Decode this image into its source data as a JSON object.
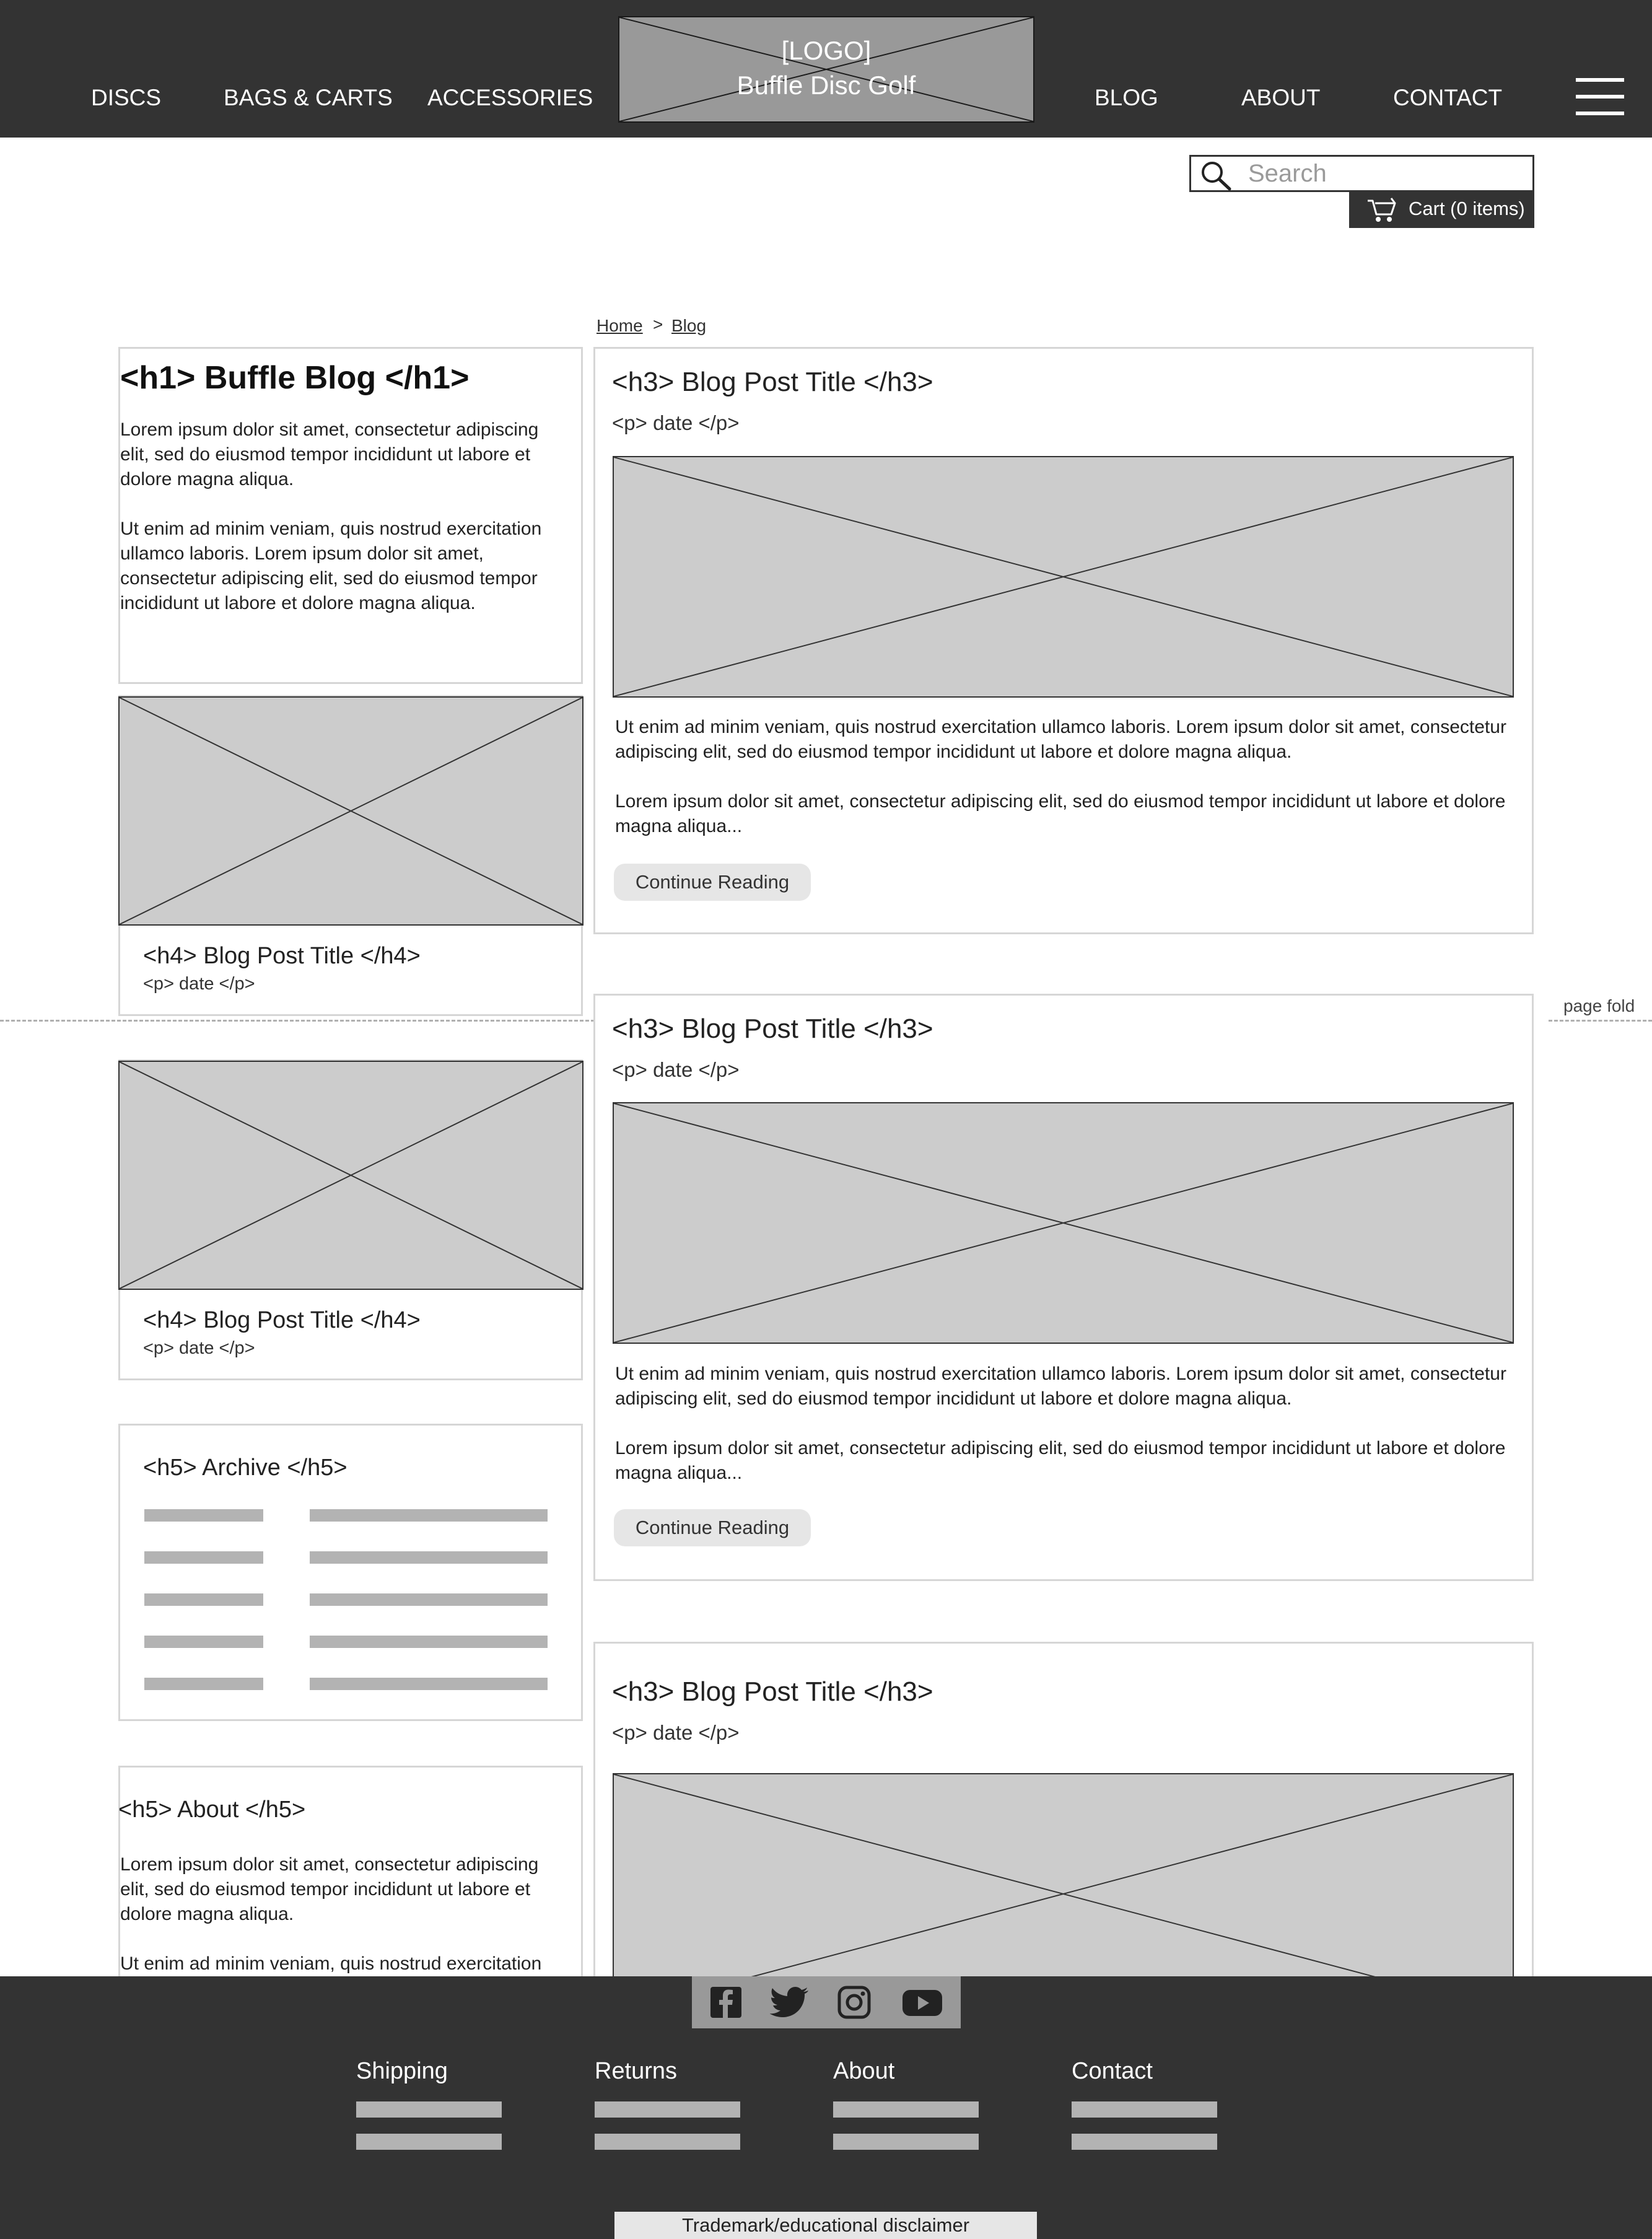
{
  "header": {
    "nav_left": [
      "DISCS",
      "BAGS & CARTS",
      "ACCESSORIES"
    ],
    "nav_right": [
      "BLOG",
      "ABOUT",
      "CONTACT"
    ],
    "logo_line1": "[LOGO]",
    "logo_line2": "Buffle Disc Golf",
    "menu_icon": "hamburger-menu-icon"
  },
  "search": {
    "placeholder": "Search",
    "icon": "search-icon"
  },
  "cart": {
    "label": "Cart (0 items)",
    "icon": "cart-icon"
  },
  "breadcrumb": {
    "home": "Home",
    "sep": ">",
    "current": "Blog"
  },
  "sidebar": {
    "intro": {
      "title": "<h1> Buffle Blog </h1>",
      "p1": "Lorem ipsum dolor sit amet, consectetur adipiscing elit, sed do eiusmod tempor incididunt ut labore et dolore magna aliqua.",
      "p2": "Ut enim ad minim veniam, quis nostrud exercitation ullamco laboris. Lorem ipsum dolor sit amet, consectetur adipiscing elit, sed do eiusmod tempor incididunt ut labore et dolore magna aliqua."
    },
    "mini_posts": [
      {
        "title": "<h4> Blog Post Title </h4>",
        "date": "<p> date </p>"
      },
      {
        "title": "<h4> Blog Post Title </h4>",
        "date": "<p> date </p>"
      }
    ],
    "archive": {
      "title": "<h5> Archive </h5>"
    },
    "about": {
      "title": "<h5> About </h5>",
      "p1": "Lorem ipsum dolor sit amet, consectetur adipiscing elit, sed do eiusmod tempor incididunt ut labore et dolore magna aliqua.",
      "p2": "Ut enim ad minim veniam, quis nostrud exercitation"
    }
  },
  "posts": [
    {
      "title": "<h3> Blog Post Title </h3>",
      "date": "<p> date </p>",
      "p1": "Ut enim ad minim veniam, quis nostrud exercitation ullamco laboris. Lorem ipsum dolor sit amet, consectetur adipiscing elit, sed do eiusmod tempor incididunt ut labore et dolore magna aliqua.",
      "p2": "Lorem ipsum dolor sit amet, consectetur adipiscing elit, sed do eiusmod tempor incididunt ut labore et dolore magna aliqua...",
      "button": "Continue Reading"
    },
    {
      "title": "<h3> Blog Post Title </h3>",
      "date": "<p> date </p>",
      "p1": "Ut enim ad minim veniam, quis nostrud exercitation ullamco laboris. Lorem ipsum dolor sit amet, consectetur adipiscing elit, sed do eiusmod tempor incididunt ut labore et dolore magna aliqua.",
      "p2": "Lorem ipsum dolor sit amet, consectetur adipiscing elit, sed do eiusmod tempor incididunt ut labore et dolore magna aliqua...",
      "button": "Continue Reading"
    },
    {
      "title": "<h3> Blog Post Title </h3>",
      "date": "<p> date </p>"
    }
  ],
  "fold_label": "page fold",
  "footer": {
    "social_icons": [
      "facebook-icon",
      "twitter-icon",
      "instagram-icon",
      "youtube-icon"
    ],
    "links": [
      "Shipping",
      "Returns",
      "About",
      "Contact"
    ],
    "disclaimer": "Trademark/educational disclaimer"
  },
  "colors": {
    "header_bg": "#333333",
    "logo_bg": "#999999",
    "placeholder_bg": "#cccccc",
    "button_bg": "#e6e6e6",
    "bar": "#b3b3b3"
  }
}
